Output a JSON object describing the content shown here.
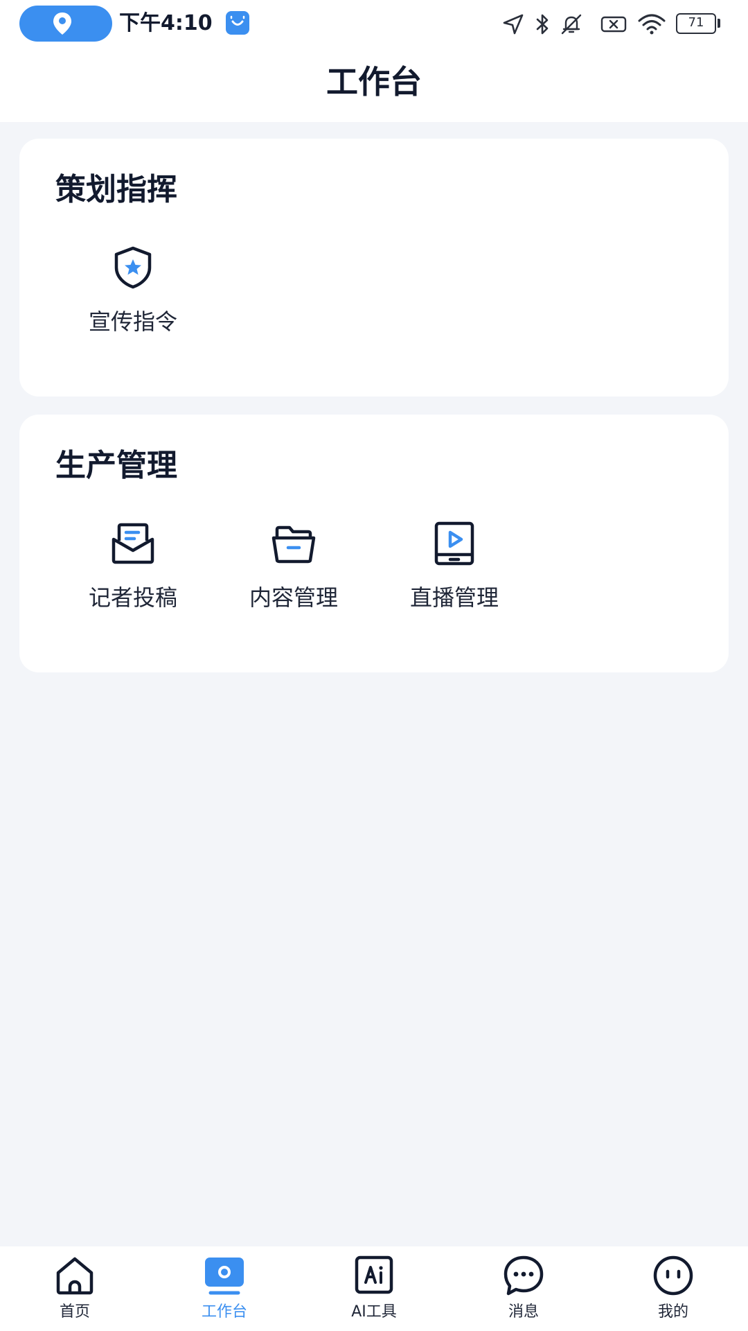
{
  "status_bar": {
    "time": "下午4:10",
    "battery": "71",
    "icons": [
      "location-pin-icon",
      "app-notification-icon",
      "navigation-arrow-icon",
      "bluetooth-icon",
      "mute-bell-icon",
      "sim-x-icon",
      "wifi-icon",
      "battery-icon"
    ]
  },
  "header": {
    "title": "工作台"
  },
  "sections": [
    {
      "title": "策划指挥",
      "tools": [
        {
          "label": "宣传指令",
          "icon": "shield-star-icon"
        }
      ]
    },
    {
      "title": "生产管理",
      "tools": [
        {
          "label": "记者投稿",
          "icon": "envelope-letter-icon"
        },
        {
          "label": "内容管理",
          "icon": "folder-icon"
        },
        {
          "label": "直播管理",
          "icon": "tablet-play-icon"
        }
      ]
    }
  ],
  "bottom_nav": {
    "items": [
      {
        "label": "首页",
        "icon": "home-icon"
      },
      {
        "label": "工作台",
        "icon": "workbench-icon"
      },
      {
        "label": "AI工具",
        "icon": "ai-icon"
      },
      {
        "label": "消息",
        "icon": "chat-bubble-icon"
      },
      {
        "label": "我的",
        "icon": "profile-face-icon"
      }
    ],
    "active_index": 1
  },
  "colors": {
    "accent": "#3b8ff0",
    "text_primary": "#121a2e",
    "background": "#f3f5f9",
    "card": "#ffffff"
  }
}
